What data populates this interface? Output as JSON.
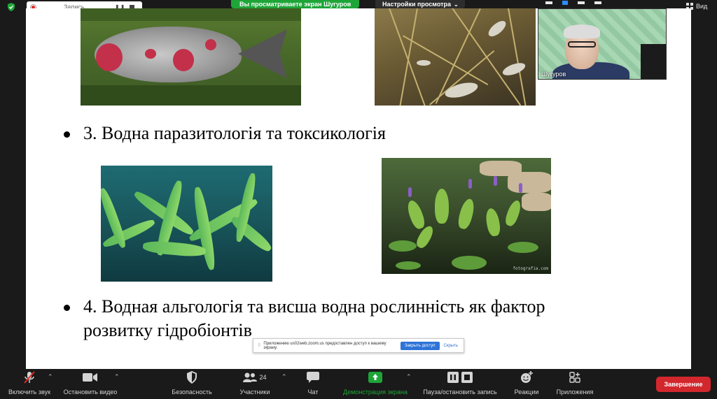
{
  "recording": {
    "status": "Запись...",
    "pause_glyph": "❚❚"
  },
  "share_banner": "Вы просматриваете экран Шугуров",
  "view_settings": {
    "label": "Настройки просмотра",
    "chevron": "⌄"
  },
  "view_label": "Вид",
  "slide": {
    "bullet3": "3.  Водна паразитологія та токсикологія",
    "bullet4_line1": "4. Водная альгологія та висша водна рослинність як фактор",
    "bullet4_line2": "розвитку гідробіонтів",
    "watermark": "fotografia.com"
  },
  "toast": {
    "icon": "⠿",
    "message": "Приложению us02web.zoom.us предоставлен доступ к вашему экрану.",
    "primary": "Закрыть доступ",
    "secondary": "Скрыть"
  },
  "video": {
    "participant": "Шугуров"
  },
  "toolbar": {
    "unmute": "Включить звук",
    "stop_video": "Остановить видео",
    "security": "Безопасность",
    "participants": "Участники",
    "participants_count": "24",
    "chat": "Чат",
    "share": "Демонстрация экрана",
    "record": "Пауза/остановить запись",
    "reactions": "Реакции",
    "apps": "Приложения",
    "end": "Завершение"
  },
  "colors": {
    "accent_green": "#1ea538",
    "end_red": "#d1272d",
    "zoom_blue": "#2d8cff"
  }
}
